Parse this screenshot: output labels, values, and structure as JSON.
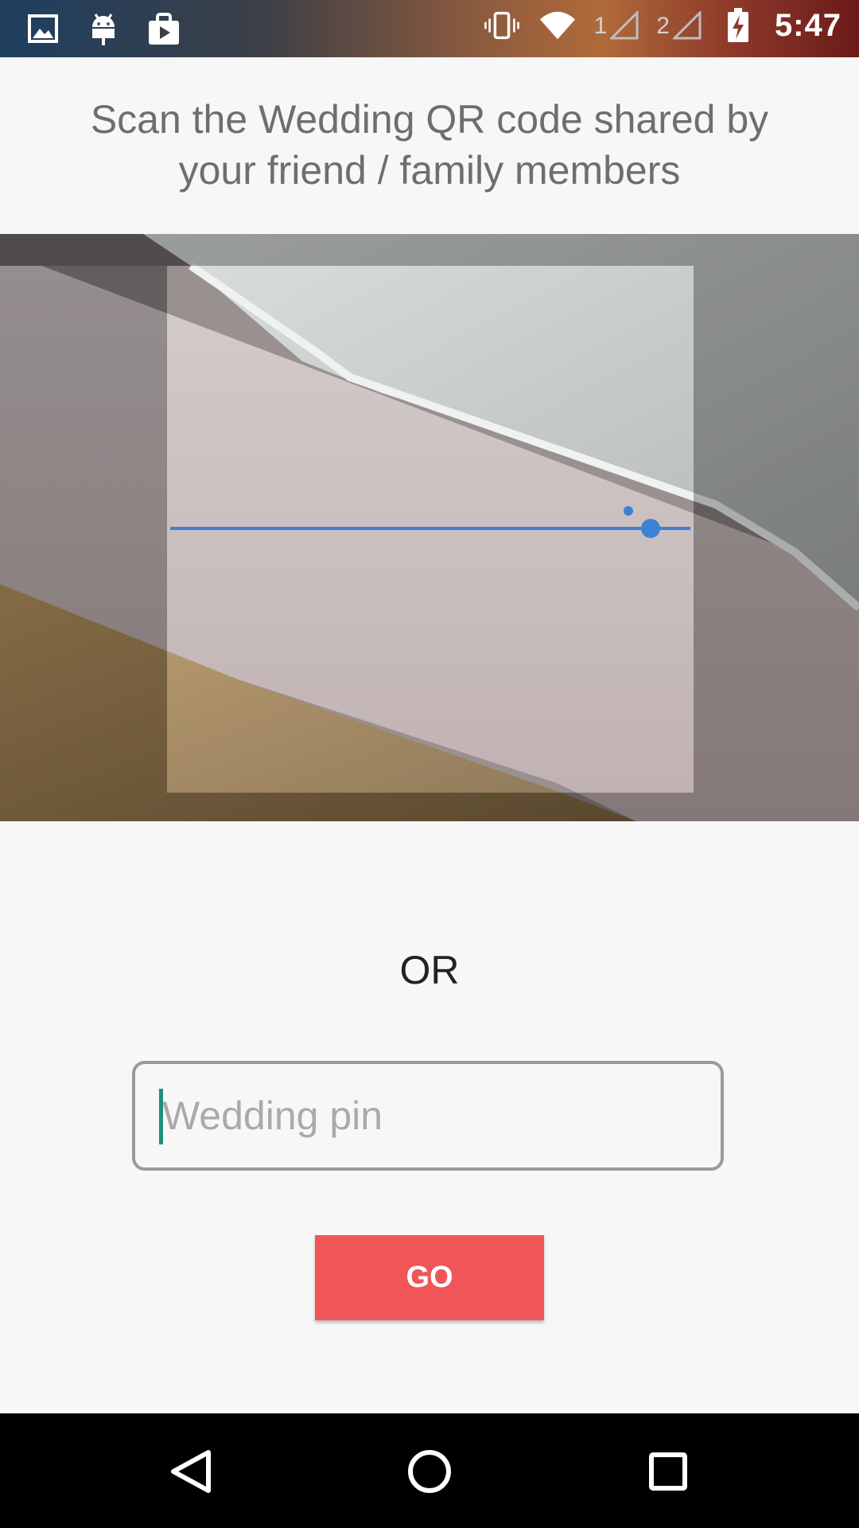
{
  "status_bar": {
    "time": "5:47",
    "sim1": "1",
    "sim2": "2",
    "icons": [
      "gallery-icon",
      "android-icon",
      "play-store-icon",
      "vibrate-icon",
      "wifi-icon",
      "signal-icon",
      "battery-charging-icon"
    ]
  },
  "header": {
    "instructions": "Scan the Wedding QR code shared by your friend / family members"
  },
  "scanner": {
    "accent_color": "#3b82d6"
  },
  "separator": {
    "label": "OR"
  },
  "pin": {
    "placeholder": "Wedding pin",
    "value": ""
  },
  "actions": {
    "go_label": "GO",
    "go_color": "#f05657"
  },
  "nav": {
    "icons": [
      "back-icon",
      "home-icon",
      "recents-icon"
    ]
  }
}
